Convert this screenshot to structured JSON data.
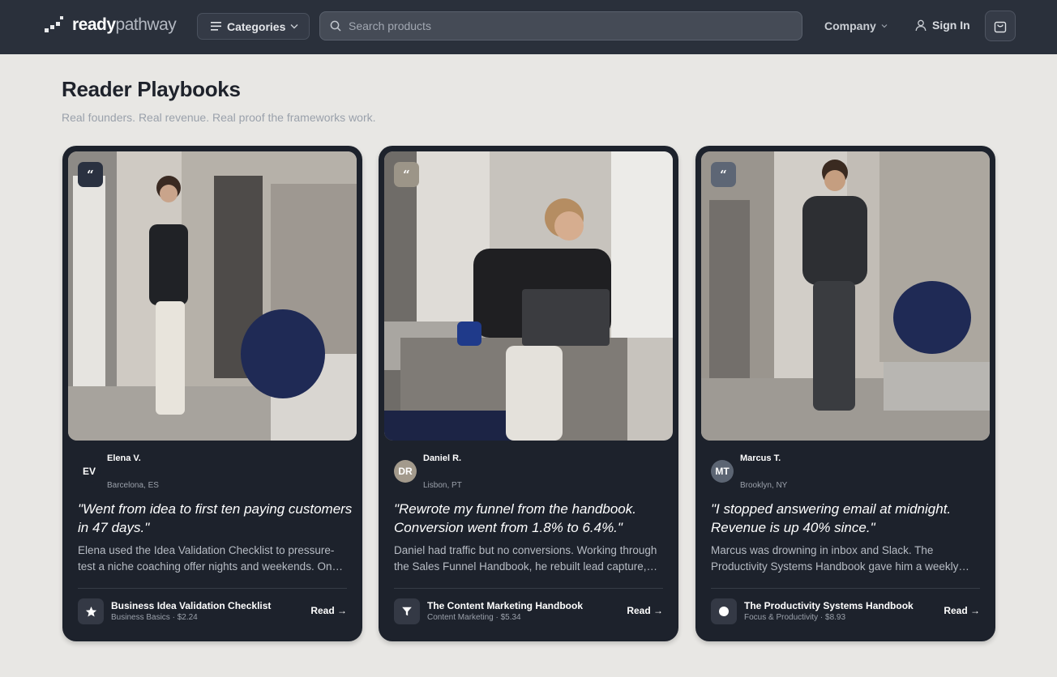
{
  "brand": {
    "part1": "ready",
    "part2": "pathway"
  },
  "header": {
    "categories_label": "Categories",
    "search_placeholder": "Search products",
    "company_label": "Company",
    "signin_label": "Sign In"
  },
  "page": {
    "title": "Reader Playbooks",
    "subtitle": "Real founders. Real revenue. Real proof the frameworks work."
  },
  "cards": [
    {
      "avatar_initials": "EV",
      "avatar_color": "#1d222c",
      "badge_color": "#2a3140",
      "name": "Elena V.",
      "location": "Barcelona, ES",
      "quote": "\"Went from idea to first ten paying customers in 47 days.\"",
      "description": "Elena used the Idea Validation Checklist to pressure-test a niche coaching offer nights and weekends. Once the numbers held, she went all in.",
      "product_icon": "star-icon",
      "product_title": "Business Idea Validation Checklist",
      "product_meta": "Business Basics · $2.24",
      "read_label": "Read →"
    },
    {
      "avatar_initials": "DR",
      "avatar_color": "#a39a8c",
      "badge_color": "#9c9588",
      "name": "Daniel R.",
      "location": "Lisbon, PT",
      "quote": "\"Rewrote my funnel from the handbook. Conversion went from 1.8% to 6.4%.\"",
      "description": "Daniel had traffic but no conversions. Working through the Sales Funnel Handbook, he rebuilt lead capture, follow-up and checkout in two weeks.",
      "product_icon": "funnel-icon",
      "product_title": "The Content Marketing Handbook",
      "product_meta": "Content Marketing · $5.34",
      "read_label": "Read →"
    },
    {
      "avatar_initials": "MT",
      "avatar_color": "#5c6573",
      "badge_color": "#5d6675",
      "name": "Marcus T.",
      "location": "Brooklyn, NY",
      "quote": "\"I stopped answering email at midnight. Revenue is up 40% since.\"",
      "description": "Marcus was drowning in inbox and Slack. The Productivity Systems Handbook gave him a weekly operating rhythm he still runs every Monday.",
      "product_icon": "circle-icon",
      "product_title": "The Productivity Systems Handbook",
      "product_meta": "Focus & Productivity · $8.93",
      "read_label": "Read →"
    }
  ]
}
